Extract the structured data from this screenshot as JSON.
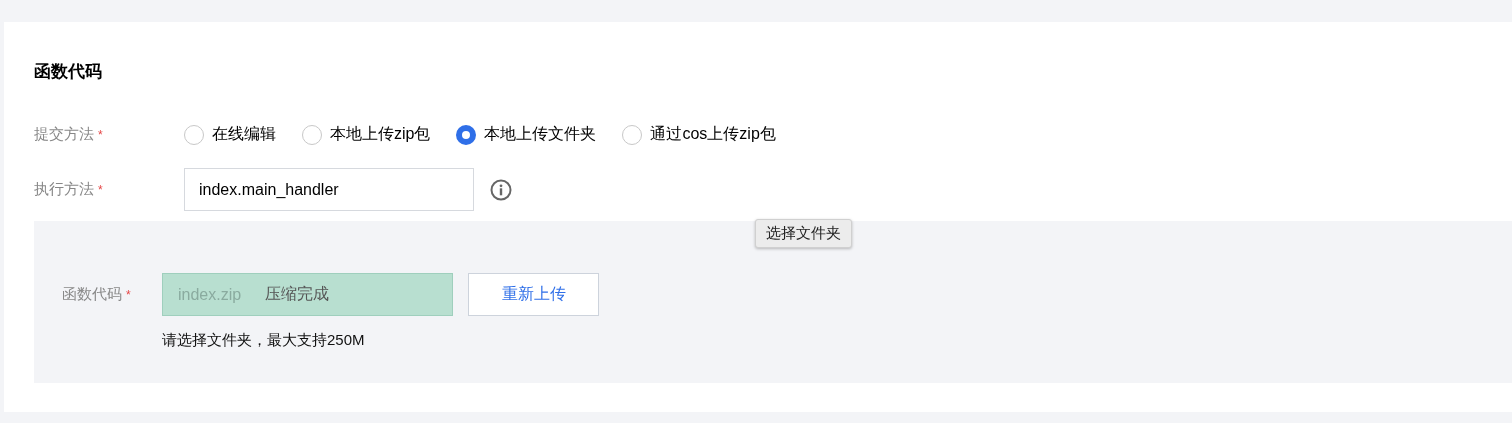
{
  "section": {
    "title": "函数代码"
  },
  "submit_method": {
    "label": "提交方法",
    "required_mark": "*",
    "options": [
      {
        "label": "在线编辑",
        "selected": false
      },
      {
        "label": "本地上传zip包",
        "selected": false
      },
      {
        "label": "本地上传文件夹",
        "selected": true
      },
      {
        "label": "通过cos上传zip包",
        "selected": false
      }
    ]
  },
  "handler": {
    "label": "执行方法",
    "required_mark": "*",
    "value": "index.main_handler"
  },
  "upload_panel": {
    "label": "函数代码",
    "required_mark": "*",
    "file_name": "index.zip",
    "status": "压缩完成",
    "reupload_button": "重新上传",
    "hint": "请选择文件夹，最大支持250M"
  },
  "tooltip": "选择文件夹"
}
